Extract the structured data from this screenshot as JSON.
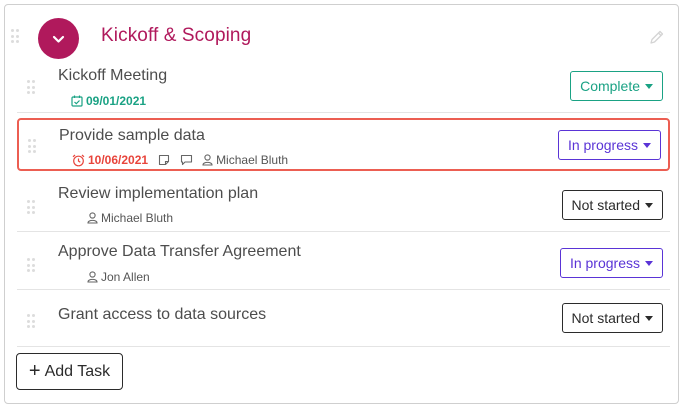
{
  "section": {
    "title": "Kickoff & Scoping"
  },
  "tasks": [
    {
      "title": "Kickoff Meeting",
      "date": "09/01/2021",
      "status": "Complete"
    },
    {
      "title": "Provide sample data",
      "date": "10/06/2021",
      "assignee": "Michael Bluth",
      "status": "In progress"
    },
    {
      "title": "Review implementation plan",
      "assignee": "Michael Bluth",
      "status": "Not started"
    },
    {
      "title": "Approve Data Transfer Agreement",
      "assignee": "Jon Allen",
      "status": "In progress"
    },
    {
      "title": "Grant access to data sources",
      "status": "Not started"
    }
  ],
  "add_task_label": "Add Task",
  "colors": {
    "brand": "#b0195c",
    "complete": "#1aa284",
    "in_progress": "#5a34d6",
    "overdue": "#e8453c"
  }
}
